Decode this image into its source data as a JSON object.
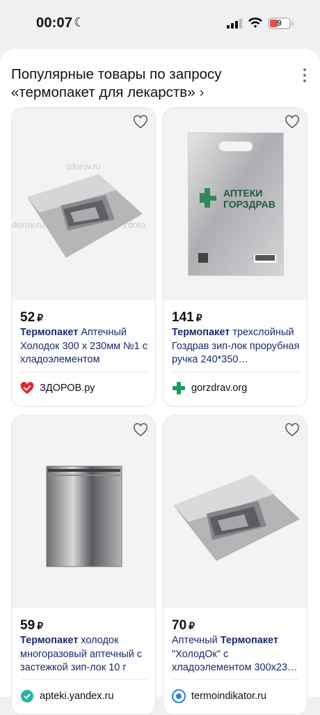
{
  "status_bar": {
    "time": "00:07",
    "battery": "9"
  },
  "section": {
    "title": "Популярные товары по запросу «термопакет для лекарств»"
  },
  "products": [
    {
      "price": "52",
      "currency": "₽",
      "title_bold": "Термопакет",
      "title_rest": " Аптечный Холодок 300 х 230мм №1 с хладоэлементом",
      "shop": "ЗДОРОВ.ру",
      "shop_icon": "heart-check-icon",
      "watermark_1": "zdorov.ru",
      "watermark_2": "dorov.ru",
      "watermark_3": "zdoro"
    },
    {
      "price": "141",
      "currency": "₽",
      "title_bold": "Термопакет",
      "title_rest": " трехслойный Гоздрав зип-лок прорубная ручка 240*350…",
      "shop": "gorzdrav.org",
      "shop_icon": "green-cross-icon",
      "bag_text_1": "АПТЕКИ",
      "bag_text_2": "ГОРЗДРАВ"
    },
    {
      "price": "59",
      "currency": "₽",
      "title_bold": "Термопакет",
      "title_rest": " холодок многоразовый аптечный с застежкой зип-лок 10 г",
      "shop": "apteki.yandex.ru",
      "shop_icon": "apteki-icon"
    },
    {
      "price": "70",
      "currency": "₽",
      "title_pre": "Аптечный ",
      "title_bold": "Термопакет",
      "title_rest": " \"ХолодОк\" с хладоэлементом 300х23…",
      "shop": "termoindikator.ru",
      "shop_icon": "termo-icon"
    }
  ]
}
